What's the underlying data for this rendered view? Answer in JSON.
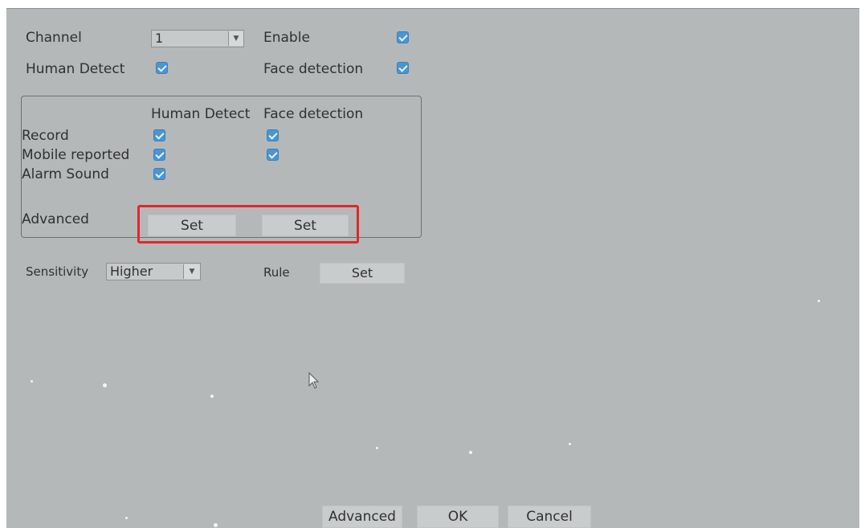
{
  "general": {
    "channel_label": "Channel",
    "channel_value": "1",
    "enable_label": "Enable",
    "human_detect_label": "Human Detect",
    "face_detection_label": "Face detection"
  },
  "actions": {
    "header_human_detect": "Human Detect",
    "header_face_detection": "Face detection",
    "record_label": "Record",
    "mobile_reported_label": "Mobile reported",
    "alarm_sound_label": "Alarm Sound",
    "advanced_label": "Advanced",
    "set_label": "Set"
  },
  "sensitivity": {
    "label": "Sensitivity",
    "value": "Higher"
  },
  "rule": {
    "label": "Rule",
    "set_label": "Set"
  },
  "footer": {
    "advanced_button": "Advanced",
    "ok_button": "OK",
    "cancel_button": "Cancel"
  },
  "checkbox_color": "#4a95d3",
  "highlight_color": "#e0282c"
}
